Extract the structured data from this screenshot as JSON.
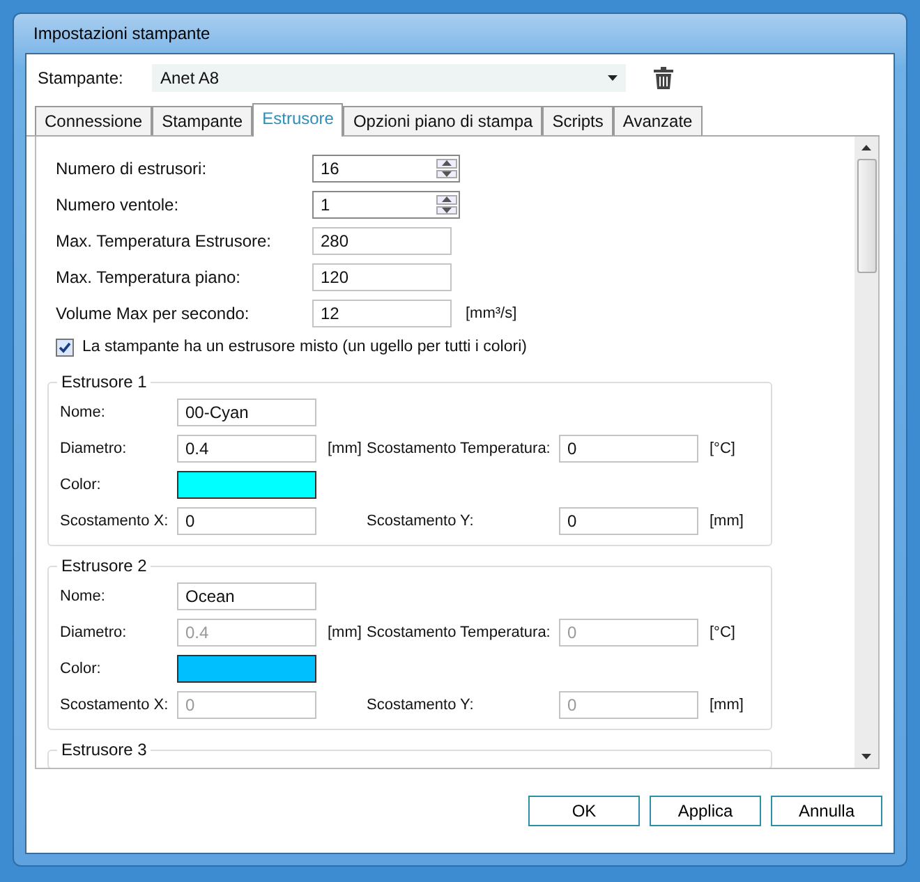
{
  "window": {
    "title": "Impostazioni stampante"
  },
  "printer": {
    "label": "Stampante:",
    "value": "Anet A8"
  },
  "tabs": [
    {
      "label": "Connessione",
      "selected": false
    },
    {
      "label": "Stampante",
      "selected": false
    },
    {
      "label": "Estrusore",
      "selected": true
    },
    {
      "label": "Opzioni piano di stampa",
      "selected": false
    },
    {
      "label": "Scripts",
      "selected": false
    },
    {
      "label": "Avanzate",
      "selected": false
    }
  ],
  "settings": [
    {
      "kind": "spinner",
      "label": "Numero di estrusori:",
      "value": "16"
    },
    {
      "kind": "spinner",
      "label": "Numero ventole:",
      "value": "1"
    },
    {
      "kind": "text",
      "label": "Max. Temperatura Estrusore:",
      "value": "280"
    },
    {
      "kind": "text",
      "label": "Max. Temperatura piano:",
      "value": "120"
    },
    {
      "kind": "text",
      "label": "Volume Max per secondo:",
      "value": "12",
      "unit": "[mm³/s]"
    }
  ],
  "mixing": {
    "label": "La stampante ha un estrusore misto (un ugello per tutti i colori)",
    "checked": true
  },
  "extruders": [
    {
      "title": "Estrusore 1",
      "rows": [
        [
          {
            "kind": "text",
            "label": "Nome:",
            "value": "00-Cyan",
            "disabled": false
          }
        ],
        [
          {
            "kind": "text",
            "label": "Diametro:",
            "value": "0.4",
            "unit": "[mm]",
            "disabled": false
          },
          {
            "kind": "text",
            "label": "Scostamento Temperatura:",
            "value": "0",
            "unit": "[°C]",
            "disabled": false
          }
        ],
        [
          {
            "kind": "color",
            "label": "Color:",
            "color": "#00ffff"
          }
        ],
        [
          {
            "kind": "text",
            "label": "Scostamento X:",
            "value": "0",
            "disabled": false
          },
          {
            "kind": "text",
            "label": "Scostamento Y:",
            "value": "0",
            "unit": "[mm]",
            "disabled": false
          }
        ]
      ]
    },
    {
      "title": "Estrusore 2",
      "rows": [
        [
          {
            "kind": "text",
            "label": "Nome:",
            "value": "Ocean",
            "disabled": false
          }
        ],
        [
          {
            "kind": "text",
            "label": "Diametro:",
            "value": "0.4",
            "unit": "[mm]",
            "disabled": true
          },
          {
            "kind": "text",
            "label": "Scostamento Temperatura:",
            "value": "0",
            "unit": "[°C]",
            "disabled": true
          }
        ],
        [
          {
            "kind": "color",
            "label": "Color:",
            "color": "#00bfff"
          }
        ],
        [
          {
            "kind": "text",
            "label": "Scostamento X:",
            "value": "0",
            "disabled": true
          },
          {
            "kind": "text",
            "label": "Scostamento Y:",
            "value": "0",
            "unit": "[mm]",
            "disabled": true
          }
        ]
      ]
    },
    {
      "title": "Estrusore 3"
    }
  ],
  "buttons": [
    "OK",
    "Applica",
    "Annulla"
  ]
}
